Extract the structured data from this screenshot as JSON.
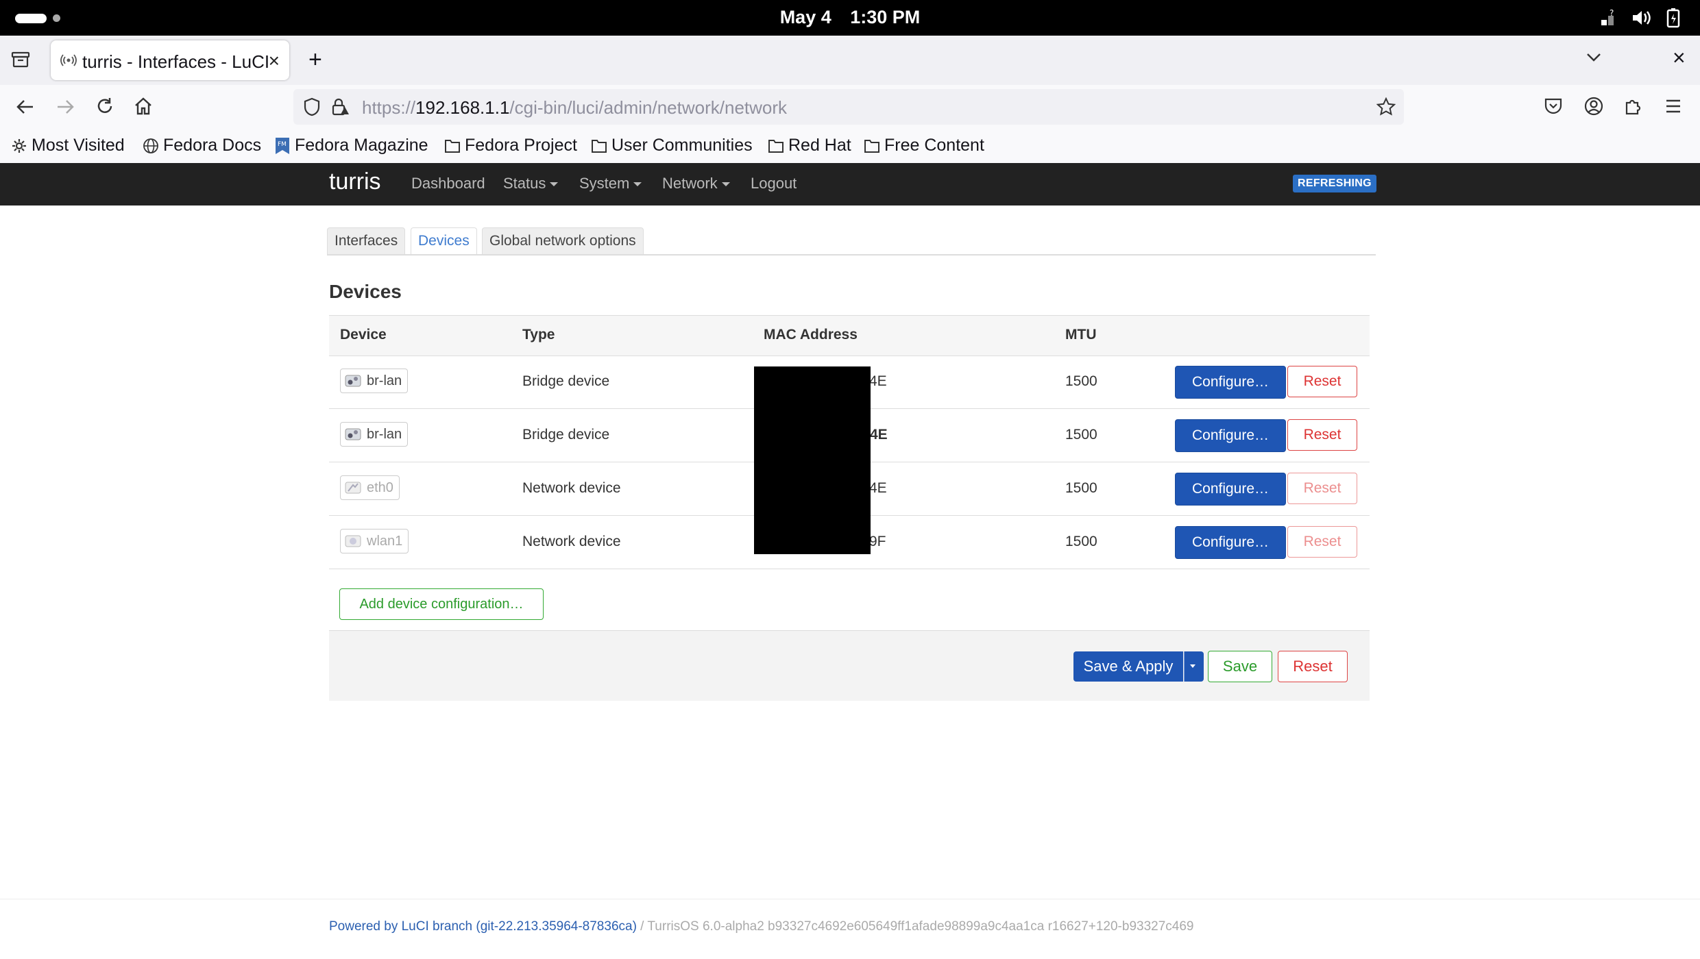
{
  "os": {
    "date": "May 4",
    "time": "1:30 PM"
  },
  "browser": {
    "tab_title": "turris - Interfaces - LuCI",
    "url_prefix": "https://",
    "url_host": "192.168.1.1",
    "url_path": "/cgi-bin/luci/admin/network/network",
    "bookmarks": [
      "Most Visited",
      "Fedora Docs",
      "Fedora Magazine",
      "Fedora Project",
      "User Communities",
      "Red Hat",
      "Free Content"
    ]
  },
  "header": {
    "brand": "turris",
    "nav": [
      "Dashboard",
      "Status",
      "System",
      "Network",
      "Logout"
    ],
    "badge": "REFRESHING"
  },
  "tabs": [
    "Interfaces",
    "Devices",
    "Global network options"
  ],
  "active_tab": "Devices",
  "section_title": "Devices",
  "table": {
    "headers": [
      "Device",
      "Type",
      "MAC Address",
      "MTU"
    ],
    "rows": [
      {
        "device": "br-lan",
        "type": "Bridge device",
        "mac_visible": "4E",
        "mtu": "1500",
        "configure": "Configure…",
        "reset": "Reset"
      },
      {
        "device": "br-lan",
        "type": "Bridge device",
        "mac_visible": ":4E",
        "mtu": "1500",
        "configure": "Configure…",
        "reset": "Reset"
      },
      {
        "device": "eth0",
        "type": "Network device",
        "mac_visible": "4E",
        "mtu": "1500",
        "configure": "Configure…",
        "reset": "Reset"
      },
      {
        "device": "wlan1",
        "type": "Network device",
        "mac_visible": "9F",
        "mtu": "1500",
        "configure": "Configure…",
        "reset": "Reset"
      }
    ]
  },
  "add_device_label": "Add device configuration…",
  "actions": {
    "save_apply": "Save & Apply",
    "save": "Save",
    "reset": "Reset"
  },
  "footer": {
    "link": "Powered by LuCI branch (git-22.213.35964-87836ca)",
    "rest": " / TurrisOS 6.0-alpha2 b93327c4692e605649ff1afade98899a9c4aa1ca r16627+120-b93327c469"
  },
  "colors": {
    "primary_button": "#1f56b4",
    "header_bg": "#222222",
    "badge": "#2b6fc5",
    "danger": "#dd3333",
    "success": "#2a9b2a"
  }
}
